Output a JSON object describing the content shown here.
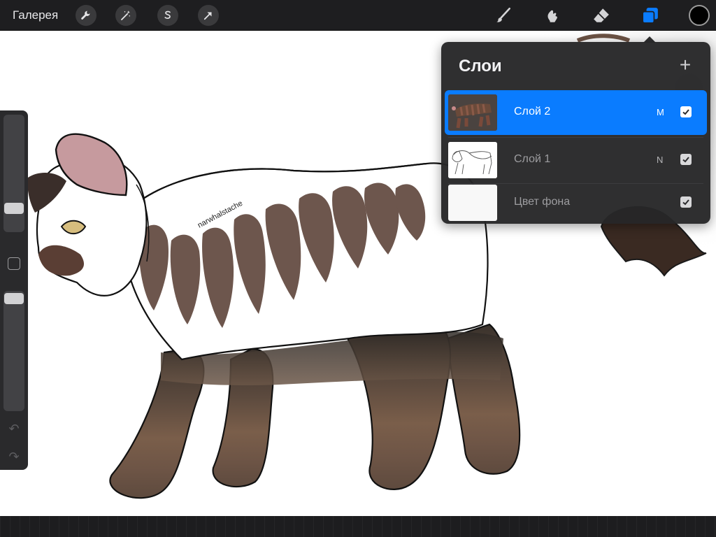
{
  "topbar": {
    "gallery_label": "Галерея",
    "left_tools": [
      "wrench-icon",
      "magic-wand-icon",
      "selection-icon",
      "transform-arrow-icon"
    ],
    "right_tools": [
      "brush-icon",
      "smudge-icon",
      "eraser-icon",
      "layers-icon"
    ],
    "active_tool": "layers-icon",
    "current_color": "#000000"
  },
  "canvas": {
    "signature_text": "narwhalstache"
  },
  "layers_panel": {
    "title": "Слои",
    "add_icon": "plus-icon",
    "layers": [
      {
        "name": "Слой 2",
        "blend_mode": "M",
        "visible": true,
        "active": true
      },
      {
        "name": "Слой 1",
        "blend_mode": "N",
        "visible": true,
        "active": false
      },
      {
        "name": "Цвет фона",
        "blend_mode": "",
        "visible": true,
        "active": false
      }
    ]
  },
  "colors": {
    "accent": "#0a7cff",
    "toolbar_bg": "#1e1e20",
    "panel_bg": "#262628"
  }
}
